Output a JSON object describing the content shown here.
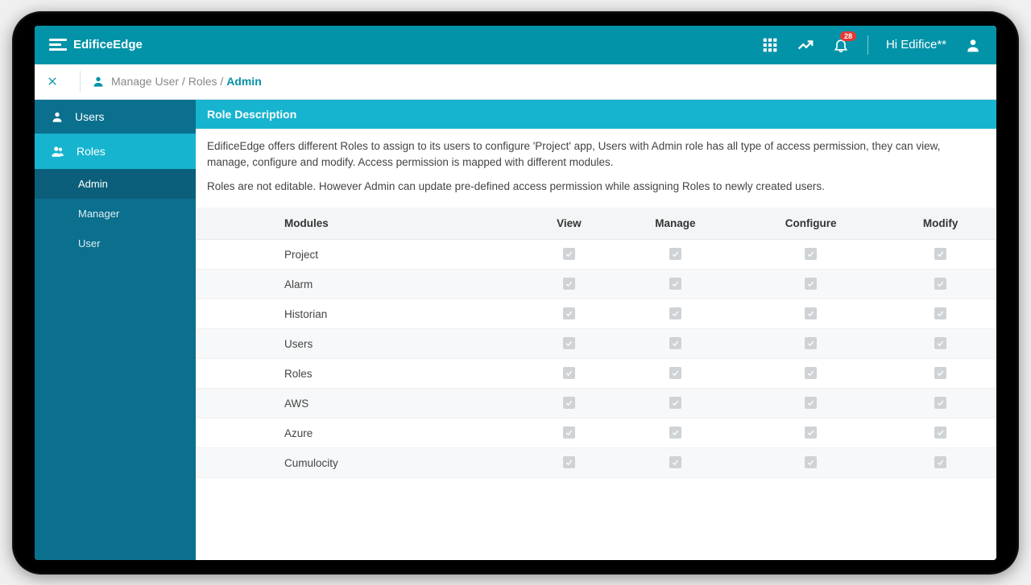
{
  "brand": {
    "name": "EdificeEdge"
  },
  "topbar": {
    "greeting": "Hi Edifice**",
    "notification_count": "28"
  },
  "breadcrumb": {
    "path1": "Manage User",
    "path2": "Roles",
    "current": "Admin"
  },
  "sidebar": {
    "items": [
      {
        "label": "Users",
        "icon": "user-icon",
        "active": false
      },
      {
        "label": "Roles",
        "icon": "users-icon",
        "active": true
      }
    ],
    "subitems": [
      {
        "label": "Admin",
        "active": true
      },
      {
        "label": "Manager",
        "active": false
      },
      {
        "label": "User",
        "active": false
      }
    ]
  },
  "panel": {
    "title": "Role Description",
    "desc1": "EdificeEdge offers different Roles to assign to its users to configure 'Project' app, Users with Admin role has all type of access permission, they can view, manage, configure and modify. Access permission is mapped with different modules.",
    "desc2": "Roles are not editable. However Admin can update pre-defined access permission while assigning Roles to newly created users."
  },
  "table": {
    "headers": [
      "Modules",
      "View",
      "Manage",
      "Configure",
      "Modify"
    ],
    "rows": [
      {
        "module": "Project",
        "view": true,
        "manage": true,
        "configure": true,
        "modify": true
      },
      {
        "module": "Alarm",
        "view": true,
        "manage": true,
        "configure": true,
        "modify": true
      },
      {
        "module": "Historian",
        "view": true,
        "manage": true,
        "configure": true,
        "modify": true
      },
      {
        "module": "Users",
        "view": true,
        "manage": true,
        "configure": true,
        "modify": true
      },
      {
        "module": "Roles",
        "view": true,
        "manage": true,
        "configure": true,
        "modify": true
      },
      {
        "module": "AWS",
        "view": true,
        "manage": true,
        "configure": true,
        "modify": true
      },
      {
        "module": "Azure",
        "view": true,
        "manage": true,
        "configure": true,
        "modify": true
      },
      {
        "module": "Cumulocity",
        "view": true,
        "manage": true,
        "configure": true,
        "modify": true
      }
    ]
  }
}
